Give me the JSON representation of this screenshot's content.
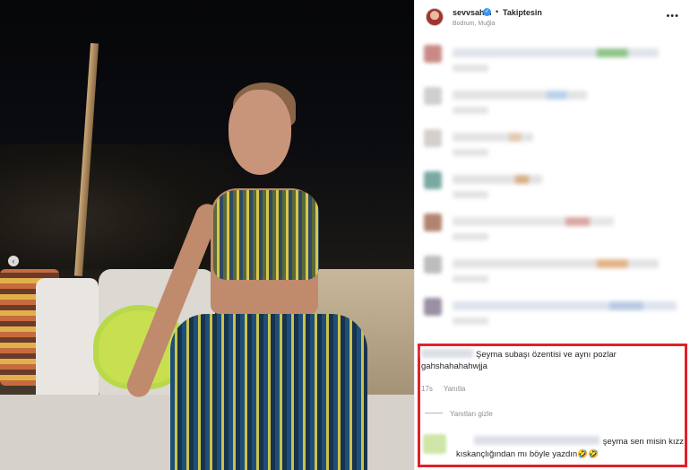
{
  "post": {
    "username": "sevvsahin",
    "verified_glyph": "✓",
    "separator": "•",
    "follow_status": "Takiptesin",
    "location": "Bodrum, Muğla",
    "more_glyph": "•••",
    "carousel_dot_glyph": "‹"
  },
  "blurred_comments": [
    {
      "avatar": "#c98a86",
      "line": "#dfe3ea",
      "accent": "#8fc48a",
      "w": 230
    },
    {
      "avatar": "#cfcfcf",
      "line": "#e3e3e3",
      "accent": "#b9d1ea",
      "w": 150
    },
    {
      "avatar": "#d4cfcc",
      "line": "#e4e4e4",
      "accent": "#e2c9b0",
      "w": 90
    },
    {
      "avatar": "#7aa9a4",
      "line": "#e2e2e2",
      "accent": "#d7b08a",
      "w": 100
    },
    {
      "avatar": "#b08470",
      "line": "#e6e6e6",
      "accent": "#d9a7a3",
      "w": 180
    },
    {
      "avatar": "#bdbdbd",
      "line": "#e3e3e3",
      "accent": "#e2b48a",
      "w": 230
    },
    {
      "avatar": "#9a8fa3",
      "line": "#dde3ec",
      "accent": "#b7c9e2",
      "w": 250
    }
  ],
  "highlighted_comment": {
    "text": "Şeyma subaşı özentisi ve aynı pozlar gahshahahahwjja",
    "time": "17s",
    "reply_label": "Yanıtla",
    "hide_replies": "Yanıtları gizle"
  },
  "reply": {
    "text_line1": "şeyma sen misin kızz",
    "text_line2": "kıskançlığından mı böyle yazdın🤣🤣"
  },
  "colors": {
    "highlight_border": "#e0202a",
    "verified": "#3897f0"
  }
}
